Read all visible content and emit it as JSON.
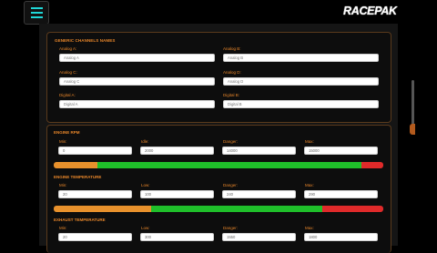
{
  "header": {
    "logo_text": "RACEPAK"
  },
  "colors": {
    "accent": "#e8862a",
    "menu": "#1fd6d6",
    "low": "#e8912c",
    "ok": "#1fbf2a",
    "danger": "#e02a2a"
  },
  "generic": {
    "title": "GENERIC CHANNELS NAMES",
    "fields": [
      {
        "label": "Analog A:",
        "placeholder": "Analog A"
      },
      {
        "label": "Analog B:",
        "placeholder": "Analog B"
      },
      {
        "label": "Analog C:",
        "placeholder": "Analog C"
      },
      {
        "label": "Analog D:",
        "placeholder": "Analog D"
      },
      {
        "label": "Digital A:",
        "placeholder": "Digital A"
      },
      {
        "label": "Digital B:",
        "placeholder": "Digital B"
      }
    ]
  },
  "rpm": {
    "title": "ENGINE RPM",
    "min_label": "Min:",
    "min_value": "0",
    "idle_label": "Idle:",
    "idle_value": "2000",
    "danger_label": "Danger:",
    "danger_value": "14000",
    "max_label": "Max:",
    "max_value": "15000",
    "bar": {
      "low": 0.133,
      "ok": 0.8,
      "danger": 0.067
    }
  },
  "temp": {
    "title": "ENGINE TEMPERATURE",
    "min_label": "Min:",
    "min_value": "20",
    "low_label": "Low:",
    "low_value": "100",
    "danger_label": "Danger:",
    "danger_value": "240",
    "max_label": "Max:",
    "max_value": "290",
    "bar": {
      "low": 0.296,
      "ok": 0.519,
      "danger": 0.185
    }
  },
  "exhaust": {
    "title": "EXHAUST TEMPERATURE",
    "min_label": "Min:",
    "min_value": "20",
    "low_label": "Low:",
    "low_value": "300",
    "danger_label": "Danger:",
    "danger_value": "1550",
    "max_label": "Max:",
    "max_value": "1800"
  }
}
